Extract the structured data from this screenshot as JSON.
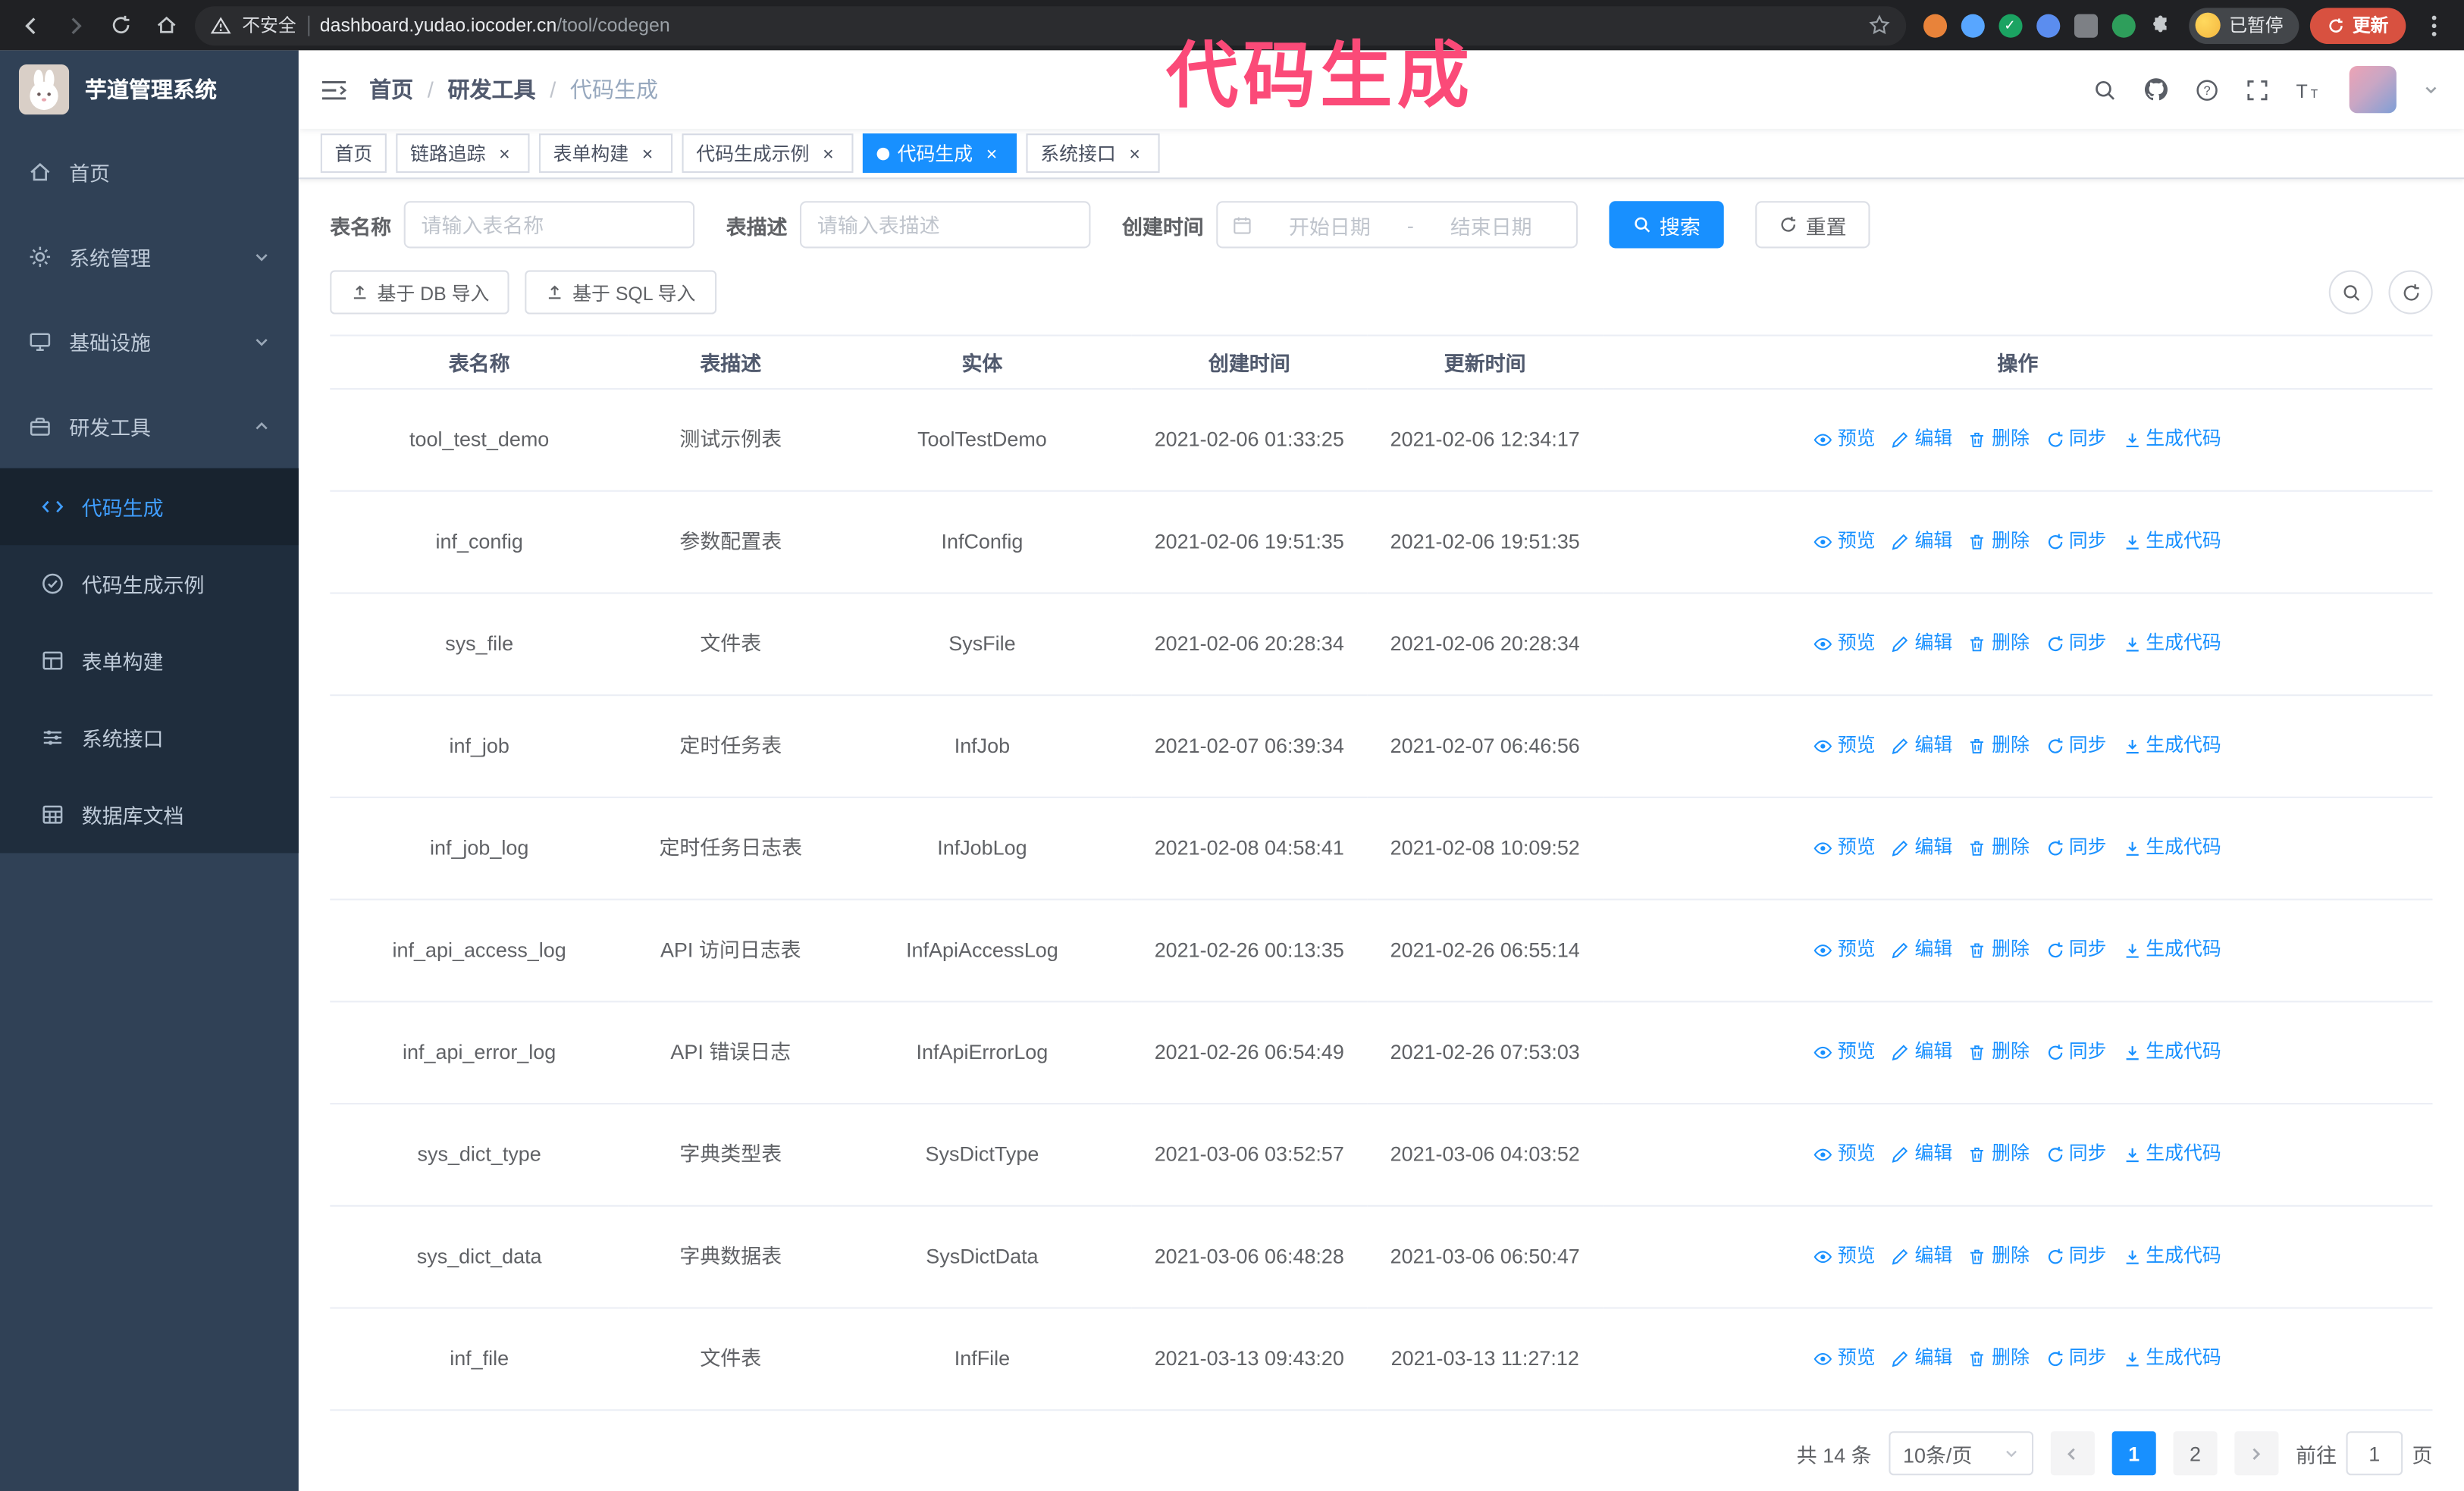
{
  "colors": {
    "accent": "#1890ff",
    "sidebar_bg": "#304156",
    "submenu_bg": "#1f2d3d",
    "active_menu_text": "#409eff",
    "annotation": "#fb4a78",
    "update_button_bg": "#d85140"
  },
  "annotation": {
    "text": "代码生成"
  },
  "browser": {
    "security_warning": "不安全",
    "url_domain": "dashboard.yudao.iocoder.cn",
    "url_path": "/tool/codegen",
    "profile_chip": "已暂停",
    "update_button": "更新"
  },
  "sidebar": {
    "logo_title": "芋道管理系统",
    "items": [
      {
        "label": "首页",
        "icon": "home"
      },
      {
        "label": "系统管理",
        "icon": "gear"
      },
      {
        "label": "基础设施",
        "icon": "monitor"
      },
      {
        "label": "研发工具",
        "icon": "toolbox"
      }
    ],
    "subitems": [
      {
        "label": "代码生成",
        "icon": "code"
      },
      {
        "label": "代码生成示例",
        "icon": "check-badge"
      },
      {
        "label": "表单构建",
        "icon": "form"
      },
      {
        "label": "系统接口",
        "icon": "sliders"
      },
      {
        "label": "数据库文档",
        "icon": "table-grid"
      }
    ]
  },
  "header": {
    "breadcrumb": {
      "items": [
        "首页",
        "研发工具",
        "代码生成"
      ],
      "separator": "/"
    }
  },
  "tabs": [
    {
      "label": "首页"
    },
    {
      "label": "链路追踪"
    },
    {
      "label": "表单构建"
    },
    {
      "label": "代码生成示例"
    },
    {
      "label": "代码生成"
    },
    {
      "label": "系统接口"
    }
  ],
  "filters": {
    "table_name_label": "表名称",
    "table_name_placeholder": "请输入表名称",
    "table_desc_label": "表描述",
    "table_desc_placeholder": "请输入表描述",
    "create_time_label": "创建时间",
    "date_start_placeholder": "开始日期",
    "date_separator": "-",
    "date_end_placeholder": "结束日期",
    "search_button": "搜索",
    "reset_button": "重置"
  },
  "toolbar": {
    "import_db_button": "基于 DB 导入",
    "import_sql_button": "基于 SQL 导入"
  },
  "table": {
    "columns": [
      "表名称",
      "表描述",
      "实体",
      "创建时间",
      "更新时间",
      "操作"
    ],
    "actions": [
      {
        "id": "preview",
        "label": "预览",
        "icon": "eye"
      },
      {
        "id": "edit",
        "label": "编辑",
        "icon": "edit"
      },
      {
        "id": "delete",
        "label": "删除",
        "icon": "trash"
      },
      {
        "id": "sync",
        "label": "同步",
        "icon": "sync"
      },
      {
        "id": "generate-code",
        "label": "生成代码",
        "icon": "download"
      }
    ],
    "rows": [
      {
        "name": "tool_test_demo",
        "desc": "测试示例表",
        "entity": "ToolTestDemo",
        "created": "2021-02-06 01:33:25",
        "updated": "2021-02-06 12:34:17"
      },
      {
        "name": "inf_config",
        "desc": "参数配置表",
        "entity": "InfConfig",
        "created": "2021-02-06 19:51:35",
        "updated": "2021-02-06 19:51:35"
      },
      {
        "name": "sys_file",
        "desc": "文件表",
        "entity": "SysFile",
        "created": "2021-02-06 20:28:34",
        "updated": "2021-02-06 20:28:34"
      },
      {
        "name": "inf_job",
        "desc": "定时任务表",
        "entity": "InfJob",
        "created": "2021-02-07 06:39:34",
        "updated": "2021-02-07 06:46:56"
      },
      {
        "name": "inf_job_log",
        "desc": "定时任务日志表",
        "entity": "InfJobLog",
        "created": "2021-02-08 04:58:41",
        "updated": "2021-02-08 10:09:52"
      },
      {
        "name": "inf_api_access_log",
        "desc": "API 访问日志表",
        "entity": "InfApiAccessLog",
        "created": "2021-02-26 00:13:35",
        "updated": "2021-02-26 06:55:14"
      },
      {
        "name": "inf_api_error_log",
        "desc": "API 错误日志",
        "entity": "InfApiErrorLog",
        "created": "2021-02-26 06:54:49",
        "updated": "2021-02-26 07:53:03"
      },
      {
        "name": "sys_dict_type",
        "desc": "字典类型表",
        "entity": "SysDictType",
        "created": "2021-03-06 03:52:57",
        "updated": "2021-03-06 04:03:52"
      },
      {
        "name": "sys_dict_data",
        "desc": "字典数据表",
        "entity": "SysDictData",
        "created": "2021-03-06 06:48:28",
        "updated": "2021-03-06 06:50:47"
      },
      {
        "name": "inf_file",
        "desc": "文件表",
        "entity": "InfFile",
        "created": "2021-03-13 09:43:20",
        "updated": "2021-03-13 11:27:12"
      }
    ]
  },
  "pagination": {
    "total_text": "共 14 条",
    "page_size": "10条/页",
    "pages": [
      "1",
      "2"
    ],
    "active_page": "1",
    "goto_label": "前往",
    "goto_value": "1",
    "goto_unit": "页"
  }
}
